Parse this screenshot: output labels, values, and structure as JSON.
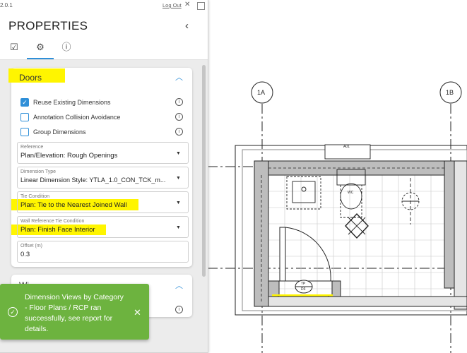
{
  "window": {
    "version": "2.0.1",
    "logout_label": "Log Out"
  },
  "panel": {
    "title": "PROPERTIES",
    "collapse_icon": "chevron-left-icon",
    "tabs": [
      {
        "icon": "checklist-icon"
      },
      {
        "icon": "gear-icon",
        "active": true
      },
      {
        "icon": "info-icon"
      }
    ]
  },
  "doors": {
    "title": "Doors",
    "checkboxes": [
      {
        "label": "Reuse Existing Dimensions",
        "checked": true
      },
      {
        "label": "Annotation Collision Avoidance",
        "checked": false
      },
      {
        "label": "Group Dimensions",
        "checked": false
      }
    ],
    "fields": [
      {
        "label": "Reference",
        "value": "Plan/Elevation: Rough Openings"
      },
      {
        "label": "Dimension Type",
        "value": "Linear Dimension Style: YTLA_1.0_CON_TCK_m..."
      },
      {
        "label": "Tie Condition",
        "value": "Plan: Tie to the Nearest Joined Wall"
      },
      {
        "label": "Wall Reference Tie Condition",
        "value": "Plan: Finish Face Interior"
      },
      {
        "label": "Offset (m)",
        "value": "0.3"
      }
    ]
  },
  "next_section_title": "Wi",
  "toast": {
    "message": "Dimension Views by Category - Floor Plans / RCP ran successfully, see report for details."
  },
  "drawing": {
    "grid_labels": [
      "1A",
      "1B"
    ],
    "room_labels": {
      "wc": "WC",
      "door_tag_top": "TP",
      "door_tag_bottom": "D3",
      "fixture_tag": "A01"
    }
  },
  "colors": {
    "accent": "#2f8fd8",
    "toast": "#6db33f",
    "highlight": "#fff500"
  }
}
